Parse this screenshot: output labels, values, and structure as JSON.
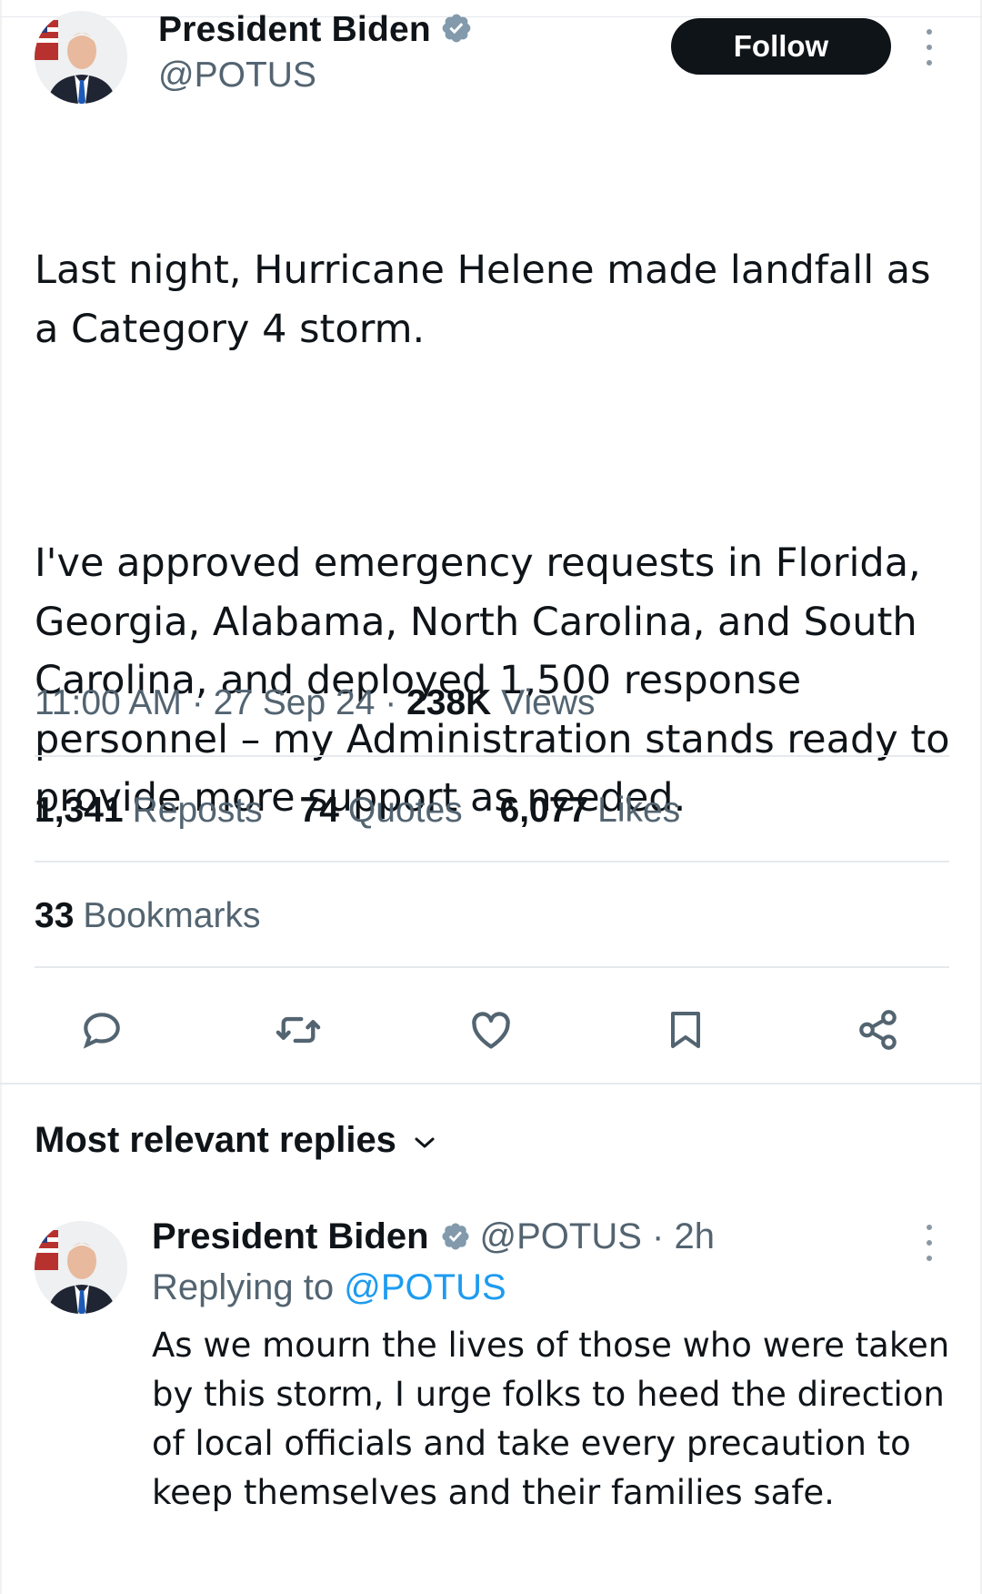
{
  "tweet": {
    "author": {
      "name": "President Biden",
      "handle": "@POTUS"
    },
    "follow_label": "Follow",
    "text_paragraphs": [
      "Last night, Hurricane Helene made landfall as a Category 4 storm.",
      "I've approved emergency requests in Florida, Georgia, Alabama, North Carolina, and South Carolina, and deployed 1,500 response personnel – my Administration stands ready to provide more support as needed."
    ],
    "time": "11:00 AM",
    "date": "27 Sep 24",
    "separator": "·",
    "views_count": "238K",
    "views_label": "Views",
    "stats": {
      "reposts_count": "1,341",
      "reposts_label": "Reposts",
      "quotes_count": "74",
      "quotes_label": "Quotes",
      "likes_count": "6,077",
      "likes_label": "Likes",
      "bookmarks_count": "33",
      "bookmarks_label": "Bookmarks"
    },
    "actions": [
      "reply-icon",
      "repost-icon",
      "like-icon",
      "bookmark-icon",
      "share-icon"
    ]
  },
  "replies": {
    "sort_label": "Most relevant replies",
    "items": [
      {
        "name": "President Biden",
        "handle_time": "@POTUS · 2h",
        "replying_prefix": "Replying to",
        "replying_mention": "@POTUS",
        "text": "As we mourn the lives of those who were taken by this storm, I urge folks to heed the direction of local officials and take every precaution to keep themselves and their families safe."
      }
    ]
  },
  "colors": {
    "text_primary": "#0f1419",
    "text_secondary": "#536471",
    "accent": "#1d9bf0",
    "divider": "#e6e9ec",
    "follow_bg": "#0f1419"
  }
}
